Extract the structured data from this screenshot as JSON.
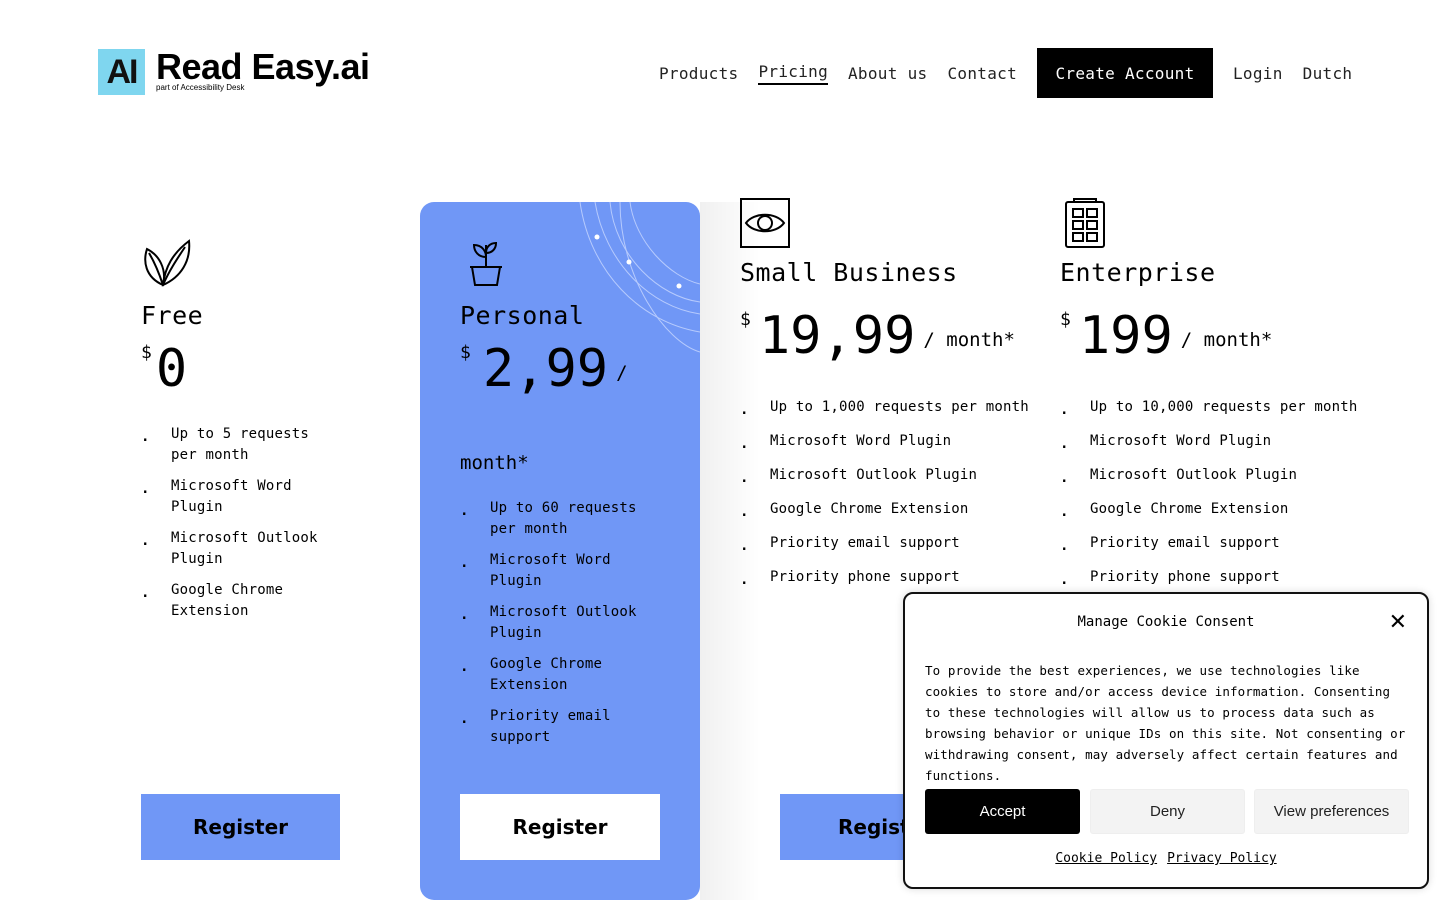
{
  "brand": {
    "mark": "AI",
    "name": "Read Easy.ai",
    "subtitle": "part of Accessibility Desk",
    "accent": "#7fd6ef"
  },
  "nav": {
    "items": [
      "Products",
      "Pricing",
      "About us",
      "Contact"
    ],
    "active": "Pricing",
    "cta": "Create Account",
    "login": "Login",
    "language": "Dutch"
  },
  "plans": [
    {
      "icon": "leaf-icon",
      "name": "Free",
      "currency": "$",
      "price": "0",
      "per": "",
      "features": [
        "Up to 5 requests per month",
        "Microsoft Word Plugin",
        "Microsoft Outlook Plugin",
        "Google Chrome Extension"
      ],
      "button": "Register"
    },
    {
      "icon": "plant-pot-icon",
      "name": "Personal",
      "currency": "$",
      "price": "2,99",
      "per": "/ month*",
      "features": [
        "Up to 60 requests per month",
        "Microsoft Word Plugin",
        "Microsoft Outlook Plugin",
        "Google Chrome Extension",
        "Priority email support"
      ],
      "button": "Register"
    },
    {
      "icon": "eye-icon",
      "name": "Small Business",
      "currency": "$",
      "price": "19,99",
      "per": "/ month*",
      "features": [
        "Up to 1,000 requests per month",
        "Microsoft Word Plugin",
        "Microsoft Outlook Plugin",
        "Google Chrome Extension",
        "Priority email support",
        "Priority phone support"
      ],
      "button": "Regist"
    },
    {
      "icon": "building-icon",
      "name": "Enterprise",
      "currency": "$",
      "price": "199",
      "per": "/ month*",
      "features": [
        "Up to 10,000 requests per month",
        "Microsoft Word Plugin",
        "Microsoft Outlook Plugin",
        "Google Chrome Extension",
        "Priority email support",
        "Priority phone support"
      ],
      "button": ""
    }
  ],
  "colors": {
    "card_blue": "#7097f6",
    "button_blue": "#7097f6",
    "black": "#000000"
  },
  "cookie": {
    "title": "Manage Cookie Consent",
    "body": "To provide the best experiences, we use technologies like cookies to store and/or access device information. Consenting to these technologies will allow us to process data such as browsing behavior or unique IDs on this site. Not consenting or withdrawing consent, may adversely affect certain features and functions.",
    "accept": "Accept",
    "deny": "Deny",
    "preferences": "View preferences",
    "cookie_policy": "Cookie Policy",
    "privacy_policy": "Privacy Policy"
  }
}
